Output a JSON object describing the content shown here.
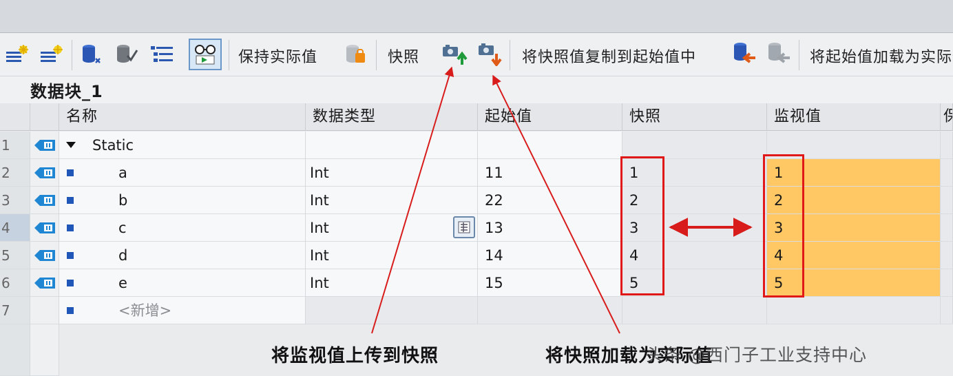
{
  "toolbar": {
    "keep_actual": "保持实际值",
    "snapshot": "快照",
    "copy_snapshot": "将快照值复制到起始值中",
    "load_start": "将起始值加载为实际值"
  },
  "block_title": "数据块_1",
  "columns": {
    "name": "名称",
    "datatype": "数据类型",
    "start": "起始值",
    "snapshot": "快照",
    "monitor": "监视值",
    "extra": "保"
  },
  "rows": [
    {
      "num": "1",
      "name": "Static",
      "dtype": "",
      "start": "",
      "snap": "",
      "mon": ""
    },
    {
      "num": "2",
      "name": "a",
      "dtype": "Int",
      "start": "11",
      "snap": "1",
      "mon": "1"
    },
    {
      "num": "3",
      "name": "b",
      "dtype": "Int",
      "start": "22",
      "snap": "2",
      "mon": "2"
    },
    {
      "num": "4",
      "name": "c",
      "dtype": "Int",
      "start": "13",
      "snap": "3",
      "mon": "3"
    },
    {
      "num": "5",
      "name": "d",
      "dtype": "Int",
      "start": "14",
      "snap": "4",
      "mon": "4"
    },
    {
      "num": "6",
      "name": "e",
      "dtype": "Int",
      "start": "15",
      "snap": "5",
      "mon": "5"
    },
    {
      "num": "7",
      "name": "<新增>",
      "dtype": "",
      "start": "",
      "snap": "",
      "mon": ""
    }
  ],
  "annotations": {
    "upload": "将监视值上传到快照",
    "load": "将快照加载为实际值"
  },
  "watermark": "头条 @西门子工业支持中心",
  "colors": {
    "monitor_fill": "#ffc864",
    "annotation_red": "#e01818",
    "bullet_blue": "#1f56b8"
  },
  "icons": [
    "insert-row-icon",
    "add-row-icon",
    "db-params-icon",
    "db-check-icon",
    "expand-list-icon",
    "monitor-glasses-icon",
    "db-keep-icon",
    "snapshot-upload-icon",
    "snapshot-download-icon",
    "copy-to-start-icon",
    "load-start-icon",
    "db-tag-icon"
  ]
}
